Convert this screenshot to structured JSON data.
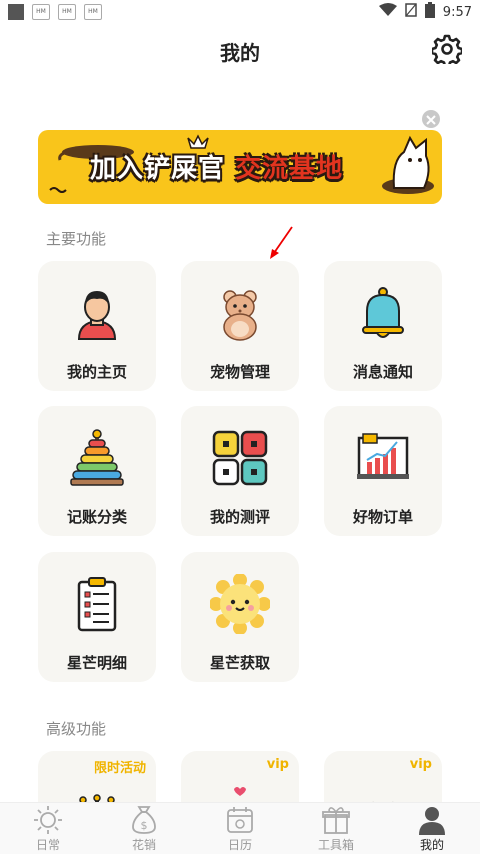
{
  "status_bar": {
    "badges": [
      "HM",
      "HM",
      "HM"
    ],
    "time": "9:57"
  },
  "header": {
    "title": "我的"
  },
  "banner": {
    "text_main": "加入铲屎官",
    "text_highlight": "交流基地",
    "bg_color": "#f9c51b"
  },
  "sections": {
    "main_title": "主要功能",
    "advanced_title": "高级功能"
  },
  "main_features": [
    {
      "label": "我的主页",
      "icon": "user-avatar-icon"
    },
    {
      "label": "宠物管理",
      "icon": "hamster-icon"
    },
    {
      "label": "消息通知",
      "icon": "bell-icon"
    },
    {
      "label": "记账分类",
      "icon": "ring-stack-icon"
    },
    {
      "label": "我的测评",
      "icon": "grid-squares-icon"
    },
    {
      "label": "好物订单",
      "icon": "bar-chart-icon"
    },
    {
      "label": "星芒明细",
      "icon": "clipboard-list-icon"
    },
    {
      "label": "星芒获取",
      "icon": "sun-face-icon"
    }
  ],
  "advanced_features": [
    {
      "tag": "限时活动",
      "icon": "crown-icon"
    },
    {
      "tag": "vip",
      "icon": "couple-icon"
    },
    {
      "tag": "vip",
      "icon": "shirt-icon"
    }
  ],
  "bottom_nav": [
    {
      "label": "日常",
      "icon": "sun-icon",
      "active": false
    },
    {
      "label": "花销",
      "icon": "money-bag-icon",
      "active": false
    },
    {
      "label": "日历",
      "icon": "calendar-icon",
      "active": false
    },
    {
      "label": "工具箱",
      "icon": "gift-box-icon",
      "active": false
    },
    {
      "label": "我的",
      "icon": "person-icon",
      "active": true
    }
  ]
}
